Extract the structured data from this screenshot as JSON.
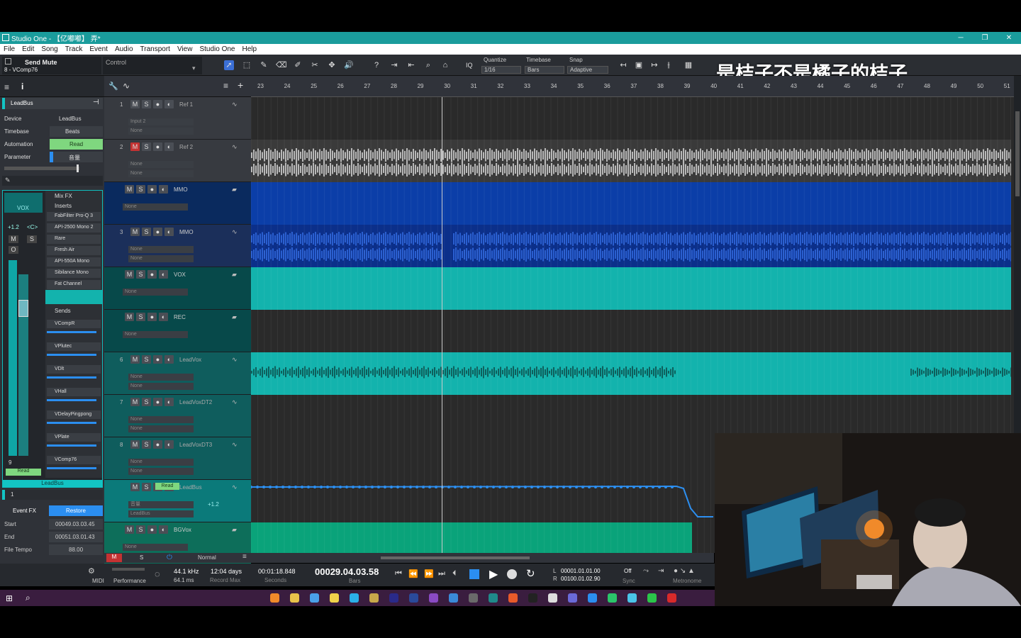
{
  "titlebar": {
    "title": "Studio One - 【亿嘟嘟】 弄*",
    "min": "─",
    "max": "❐",
    "close": "✕"
  },
  "menu": [
    "File",
    "Edit",
    "Song",
    "Track",
    "Event",
    "Audio",
    "Transport",
    "View",
    "Studio One",
    "Help"
  ],
  "toolbar": {
    "action_label": "Send Mute",
    "action_sub": "8 - VComp76",
    "control_label": "Control",
    "quantize_label": "Quantize",
    "quantize_value": "1/16",
    "timebase_label": "Timebase",
    "timebase_value": "Bars",
    "snap_label": "Snap",
    "snap_value": "Adaptive",
    "iq": "IQ"
  },
  "watermark": "是桔子不是橘子的桔子",
  "inspector": {
    "channel": "LeadBus",
    "device_label": "Device",
    "device_value": "LeadBus",
    "timebase_label": "Timebase",
    "timebase_value": "Beats",
    "automation_label": "Automation",
    "automation_value": "Read",
    "parameter_label": "Parameter",
    "parameter_value": "音量",
    "event_fx_label": "Event FX",
    "restore_label": "Restore",
    "start_label": "Start",
    "start_value": "00049.03.03.45",
    "end_label": "End",
    "end_value": "00051.03.01.43",
    "tempo_label": "File Tempo",
    "tempo_value": "88.00",
    "event_number": "1"
  },
  "console": {
    "channel_name": "VOX",
    "volume": "+1.2",
    "pan": "<C>",
    "mix_fx": "Mix FX",
    "inserts_label": "Inserts",
    "sends_label": "Sends",
    "footer": "LeadBus",
    "auto": "Read",
    "channel_num": "9",
    "inserts": [
      "FabFilter Pro-Q 3",
      "API-2500 Mono 2",
      "Rare",
      "Fresh Air",
      "API-550A Mono",
      "Sibilance Mono",
      "Fat Channel"
    ],
    "sends": [
      "VCompR",
      "VPlutec",
      "VDlt",
      "VHall",
      "VDelayPingpong",
      "VPlate",
      "VComp76"
    ]
  },
  "tracks": [
    {
      "num": "1",
      "name": "Ref 1",
      "in": "Input 2",
      "out": "None"
    },
    {
      "num": "2",
      "name": "Ref 2",
      "in": "None",
      "out": "None"
    },
    {
      "num": "",
      "name": "MMO",
      "in": "None",
      "out": ""
    },
    {
      "num": "3",
      "name": "MMO",
      "in": "None",
      "out": "None"
    },
    {
      "num": "",
      "name": "VOX",
      "in": "None",
      "out": ""
    },
    {
      "num": "",
      "name": "REC",
      "in": "None",
      "out": ""
    },
    {
      "num": "6",
      "name": "LeadVox",
      "in": "None",
      "out": "None"
    },
    {
      "num": "7",
      "name": "LeadVoxDT2",
      "in": "None",
      "out": "None"
    },
    {
      "num": "8",
      "name": "LeadVoxDT3",
      "in": "None",
      "out": "None"
    },
    {
      "num": "",
      "name": "LeadBus",
      "in": "音量",
      "out": "LeadBus",
      "extra": "+1.2",
      "read": "Read"
    },
    {
      "num": "",
      "name": "BGVox",
      "in": "None",
      "out": ""
    }
  ],
  "ruler": [
    "23",
    "24",
    "25",
    "26",
    "27",
    "28",
    "29",
    "30",
    "31",
    "32",
    "33",
    "34",
    "35",
    "36",
    "37",
    "38",
    "39",
    "40",
    "41",
    "42",
    "43",
    "44",
    "45",
    "46",
    "47",
    "48",
    "49",
    "50",
    "51"
  ],
  "transport": {
    "midi": "MIDI",
    "performance": "Performance",
    "sample_rate": "44.1 kHz",
    "latency": "64.1 ms",
    "record_days": "12:04 days",
    "record_max": "Record Max",
    "seconds_value": "00:01:18.848",
    "seconds_label": "Seconds",
    "bars_value": "00029.04.03.58",
    "bars_label": "Bars",
    "loop_l": "00001.01.01.00",
    "loop_r": "00100.01.02.90",
    "loop_l_label": "L",
    "loop_r_label": "R",
    "sync_value": "Off",
    "sync_label": "Sync",
    "metronome_label": "Metronome",
    "mode": "Normal"
  },
  "colors": {
    "teal": "#1a9c9c",
    "blue": "#0b3ea8",
    "green": "#0aa37a",
    "aqua": "#13b3ad"
  }
}
